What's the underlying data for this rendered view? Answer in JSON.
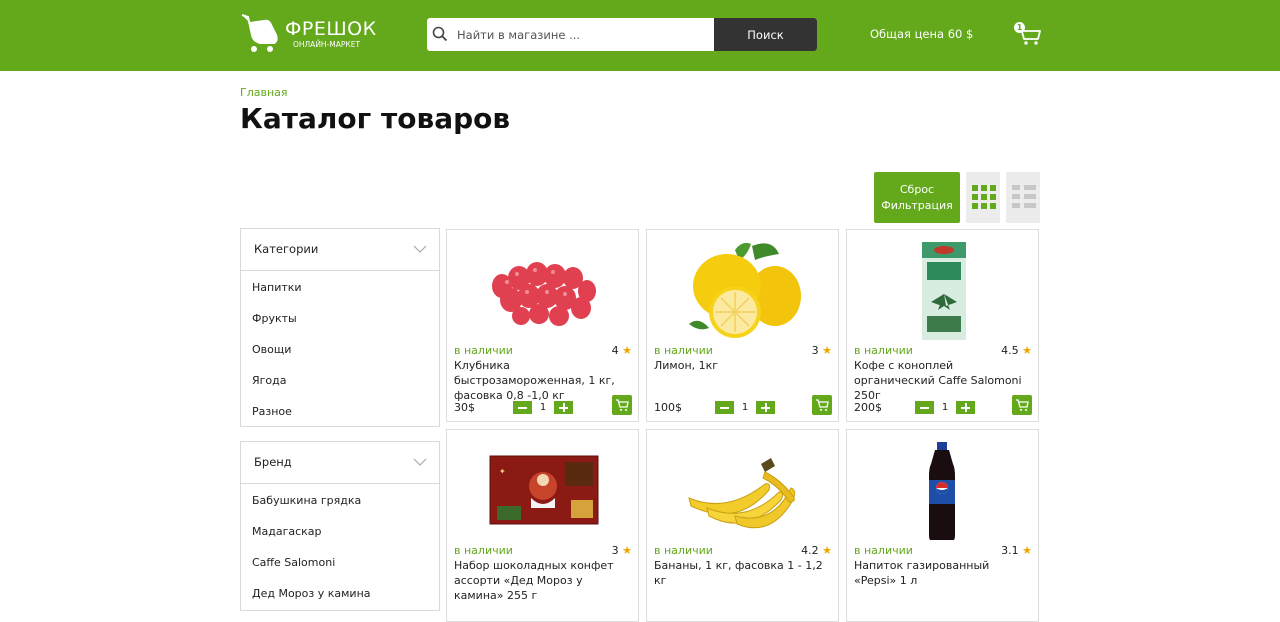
{
  "header": {
    "logo_title": "ФРЕШОК",
    "logo_subtitle": "ОНЛАЙН-МАРКЕТ",
    "search_placeholder": "Найти в магазине ...",
    "search_button": "Поиск",
    "total_price": "Общая цена 60 $",
    "cart_count": "1"
  },
  "breadcrumb": "Главная",
  "page_title": "Каталог товаров",
  "toolbar": {
    "reset_label_line1": "Сброс",
    "reset_label_line2": "Фильтрация"
  },
  "filters": {
    "categories": {
      "title": "Категории",
      "items": [
        "Напитки",
        "Фрукты",
        "Овощи",
        "Ягода",
        "Разное"
      ]
    },
    "brand": {
      "title": "Бренд",
      "items": [
        "Бабушкина грядка",
        "Мадагаскар",
        "Caffe Salomoni",
        "Дед Мороз у камина"
      ]
    }
  },
  "products": [
    {
      "availability": "в наличии",
      "rating": "4",
      "name": "Клубника быстрозамороженная, 1 кг, фасовка 0,8 -1,0 кг",
      "price": "30$",
      "qty": "1",
      "image": "strawberry-image"
    },
    {
      "availability": "в наличии",
      "rating": "3",
      "name": "Лимон, 1кг",
      "price": "100$",
      "qty": "1",
      "image": "lemon-image"
    },
    {
      "availability": "в наличии",
      "rating": "4.5",
      "name": "Кофе с коноплей органический Caffe Salomoni 250г",
      "price": "200$",
      "qty": "1",
      "image": "coffee-pack-image"
    },
    {
      "availability": "в наличии",
      "rating": "3",
      "name": "Набор шоколадных конфет ассорти «Дед Мороз у камина» 255 г",
      "image": "chocolate-box-image"
    },
    {
      "availability": "в наличии",
      "rating": "4.2",
      "name": "Бананы, 1 кг, фасовка 1 - 1,2 кг",
      "image": "banana-image"
    },
    {
      "availability": "в наличии",
      "rating": "3.1",
      "name": "Напиток газированный «Pepsi» 1 л",
      "image": "pepsi-bottle-image"
    }
  ],
  "colors": {
    "brand": "#63a91b",
    "dark": "#333333",
    "star": "#f0a500"
  }
}
